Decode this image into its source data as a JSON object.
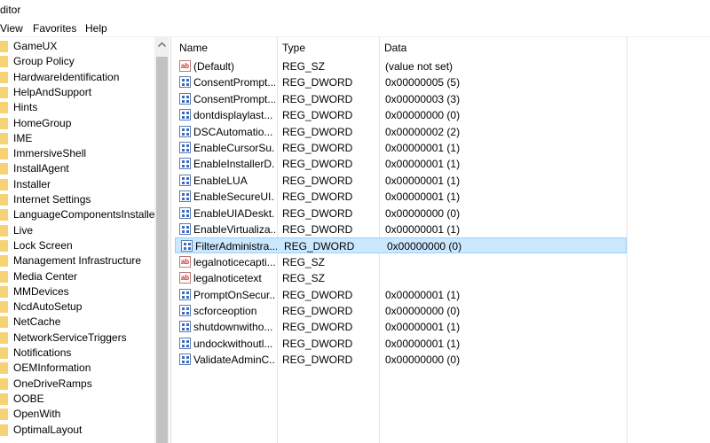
{
  "window": {
    "title": "ditor"
  },
  "menu": {
    "items": [
      "View",
      "Favorites",
      "Help"
    ]
  },
  "tree": {
    "items": [
      "GameUX",
      "Group Policy",
      "HardwareIdentification",
      "HelpAndSupport",
      "Hints",
      "HomeGroup",
      "IME",
      "ImmersiveShell",
      "InstallAgent",
      "Installer",
      "Internet Settings",
      "LanguageComponentsInstaller",
      "Live",
      "Lock Screen",
      "Management Infrastructure",
      "Media Center",
      "MMDevices",
      "NcdAutoSetup",
      "NetCache",
      "NetworkServiceTriggers",
      "Notifications",
      "OEMInformation",
      "OneDriveRamps",
      "OOBE",
      "OpenWith",
      "OptimalLayout"
    ]
  },
  "list": {
    "columns": {
      "name": "Name",
      "type": "Type",
      "data": "Data"
    },
    "selected_index": 11,
    "rows": [
      {
        "icon": "string-value-icon",
        "name": "(Default)",
        "type": "REG_SZ",
        "data": "(value not set)"
      },
      {
        "icon": "dword-value-icon",
        "name": "ConsentPrompt...",
        "type": "REG_DWORD",
        "data": "0x00000005 (5)"
      },
      {
        "icon": "dword-value-icon",
        "name": "ConsentPrompt...",
        "type": "REG_DWORD",
        "data": "0x00000003 (3)"
      },
      {
        "icon": "dword-value-icon",
        "name": "dontdisplaylast...",
        "type": "REG_DWORD",
        "data": "0x00000000 (0)"
      },
      {
        "icon": "dword-value-icon",
        "name": "DSCAutomatio...",
        "type": "REG_DWORD",
        "data": "0x00000002 (2)"
      },
      {
        "icon": "dword-value-icon",
        "name": "EnableCursorSu...",
        "type": "REG_DWORD",
        "data": "0x00000001 (1)"
      },
      {
        "icon": "dword-value-icon",
        "name": "EnableInstallerD...",
        "type": "REG_DWORD",
        "data": "0x00000001 (1)"
      },
      {
        "icon": "dword-value-icon",
        "name": "EnableLUA",
        "type": "REG_DWORD",
        "data": "0x00000001 (1)"
      },
      {
        "icon": "dword-value-icon",
        "name": "EnableSecureUI...",
        "type": "REG_DWORD",
        "data": "0x00000001 (1)"
      },
      {
        "icon": "dword-value-icon",
        "name": "EnableUIADeskt...",
        "type": "REG_DWORD",
        "data": "0x00000000 (0)"
      },
      {
        "icon": "dword-value-icon",
        "name": "EnableVirtualiza...",
        "type": "REG_DWORD",
        "data": "0x00000001 (1)"
      },
      {
        "icon": "dword-value-icon",
        "name": "FilterAdministra...",
        "type": "REG_DWORD",
        "data": "0x00000000 (0)"
      },
      {
        "icon": "string-value-icon",
        "name": "legalnoticecapti...",
        "type": "REG_SZ",
        "data": ""
      },
      {
        "icon": "string-value-icon",
        "name": "legalnoticetext",
        "type": "REG_SZ",
        "data": ""
      },
      {
        "icon": "dword-value-icon",
        "name": "PromptOnSecur...",
        "type": "REG_DWORD",
        "data": "0x00000001 (1)"
      },
      {
        "icon": "dword-value-icon",
        "name": "scforceoption",
        "type": "REG_DWORD",
        "data": "0x00000000 (0)"
      },
      {
        "icon": "dword-value-icon",
        "name": "shutdownwitho...",
        "type": "REG_DWORD",
        "data": "0x00000001 (1)"
      },
      {
        "icon": "dword-value-icon",
        "name": "undockwithoutl...",
        "type": "REG_DWORD",
        "data": "0x00000001 (1)"
      },
      {
        "icon": "dword-value-icon",
        "name": "ValidateAdminC...",
        "type": "REG_DWORD",
        "data": "0x00000000 (0)"
      }
    ]
  },
  "colors": {
    "selection_fill": "#cce8ff",
    "selection_border": "#99d1ff",
    "folder": "#f5d374",
    "scroll_thumb": "#c2c2c2"
  }
}
